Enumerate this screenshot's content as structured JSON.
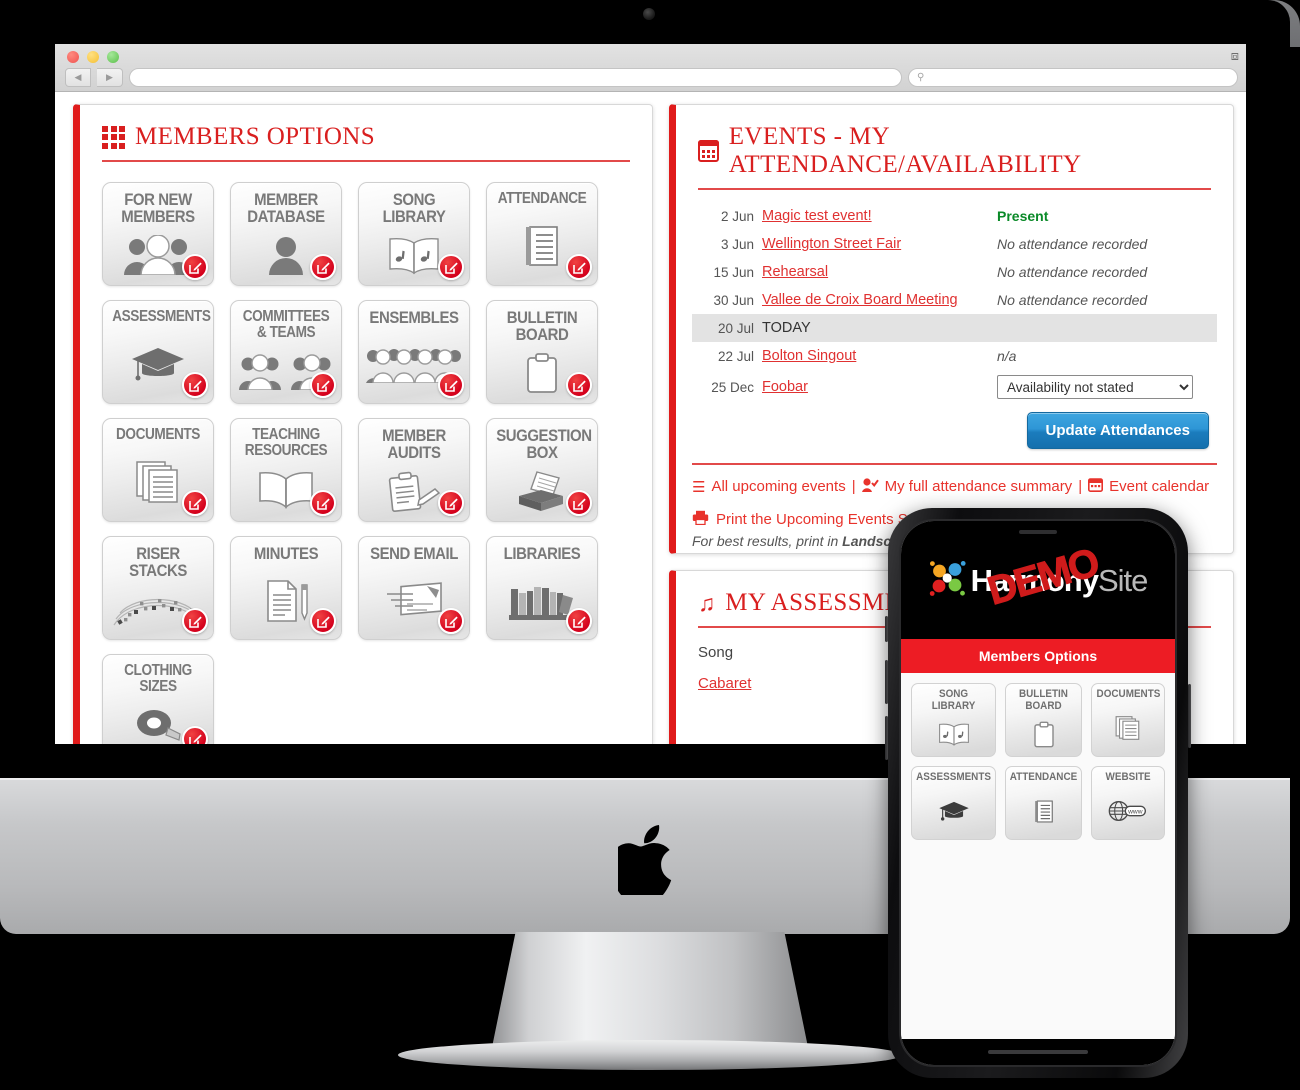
{
  "browser": {
    "url_placeholder": "",
    "search_placeholder": "",
    "back_icon": "back-arrow-icon",
    "forward_icon": "forward-arrow-icon",
    "expand_icon": "expand-icon"
  },
  "members_panel": {
    "title": "MEMBERS OPTIONS",
    "icon": "grid-icon",
    "tiles": [
      {
        "label": "FOR NEW MEMBERS",
        "art": "three-people-icon"
      },
      {
        "label": "MEMBER DATABASE",
        "art": "person-icon"
      },
      {
        "label": "SONG LIBRARY",
        "art": "music-book-icon"
      },
      {
        "label": "ATTENDANCE",
        "art": "checklist-icon"
      },
      {
        "label": "ASSESSMENTS",
        "art": "graduation-cap-icon"
      },
      {
        "label": "COMMITTEES & TEAMS",
        "art": "two-groups-icon"
      },
      {
        "label": "ENSEMBLES",
        "art": "crowd-icon"
      },
      {
        "label": "BULLETIN BOARD",
        "art": "clipboard-icon"
      },
      {
        "label": "DOCUMENTS",
        "art": "documents-stack-icon"
      },
      {
        "label": "TEACHING RESOURCES",
        "art": "open-book-icon"
      },
      {
        "label": "MEMBER AUDITS",
        "art": "clipboard-pen-icon"
      },
      {
        "label": "SUGGESTION BOX",
        "art": "suggestion-box-icon"
      },
      {
        "label": "RISER STACKS",
        "art": "riser-arc-icon"
      },
      {
        "label": "MINUTES",
        "art": "document-pencil-icon"
      },
      {
        "label": "SEND EMAIL",
        "art": "envelope-icon"
      },
      {
        "label": "LIBRARIES",
        "art": "books-shelf-icon"
      },
      {
        "label": "CLOTHING SIZES",
        "art": "tape-measure-icon"
      }
    ],
    "edit_badge": "edit-pencil-icon"
  },
  "events_panel": {
    "title": "EVENTS - MY ATTENDANCE/AVAILABILITY",
    "icon": "calendar-icon",
    "rows": [
      {
        "date": "2 Jun",
        "name": "Magic test event!",
        "status": "Present",
        "status_type": "present"
      },
      {
        "date": "3 Jun",
        "name": "Wellington Street Fair",
        "status": "No attendance recorded",
        "status_type": "italic"
      },
      {
        "date": "15 Jun",
        "name": "Rehearsal",
        "status": "No attendance recorded",
        "status_type": "italic"
      },
      {
        "date": "30 Jun",
        "name": "Vallee de Croix Board Meeting",
        "status": "No attendance recorded",
        "status_type": "italic"
      },
      {
        "date": "20 Jul",
        "name": "TODAY",
        "status": "",
        "status_type": "today"
      },
      {
        "date": "22 Jul",
        "name": "Bolton Singout",
        "status": "n/a",
        "status_type": "italic"
      },
      {
        "date": "25 Dec",
        "name": "Foobar",
        "status": "",
        "status_type": "select"
      }
    ],
    "availability_select": "Availability not stated",
    "update_button": "Update Attendances",
    "links": [
      {
        "label": "All upcoming events",
        "icon": "list-icon"
      },
      {
        "label": "My full attendance summary",
        "icon": "person-check-icon"
      },
      {
        "label": "Event calendar",
        "icon": "calendar-small-icon"
      }
    ],
    "separator": "|",
    "print_link": {
      "label": "Print the Upcoming Events Summary Sheet",
      "icon": "printer-icon"
    },
    "print_note_prefix": "For best results, print in ",
    "print_note_bold": "Landscape"
  },
  "assessments_panel": {
    "title": "MY ASSESSMENTS",
    "icon": "music-note-icon",
    "column_header": "Song",
    "items": [
      "Cabaret"
    ]
  },
  "phone": {
    "logo": {
      "word": "Harmony",
      "suffix": "Site",
      "overlay": "DEMO",
      "mark": "harmonysite-dots-icon"
    },
    "bar_label": "Members Options",
    "tiles": [
      {
        "label": "SONG LIBRARY",
        "art": "music-book-icon"
      },
      {
        "label": "BULLETIN BOARD",
        "art": "clipboard-icon"
      },
      {
        "label": "DOCUMENTS",
        "art": "documents-stack-icon"
      },
      {
        "label": "ASSESSMENTS",
        "art": "graduation-cap-icon"
      },
      {
        "label": "ATTENDANCE",
        "art": "checklist-icon"
      },
      {
        "label": "WEBSITE",
        "art": "globe-www-icon"
      }
    ]
  },
  "colors": {
    "brand_red": "#e01b1b",
    "link_red": "#e03131",
    "present_green": "#0a8a28",
    "button_blue": "#1b7cbd",
    "phone_bar_red": "#ed1c24"
  }
}
